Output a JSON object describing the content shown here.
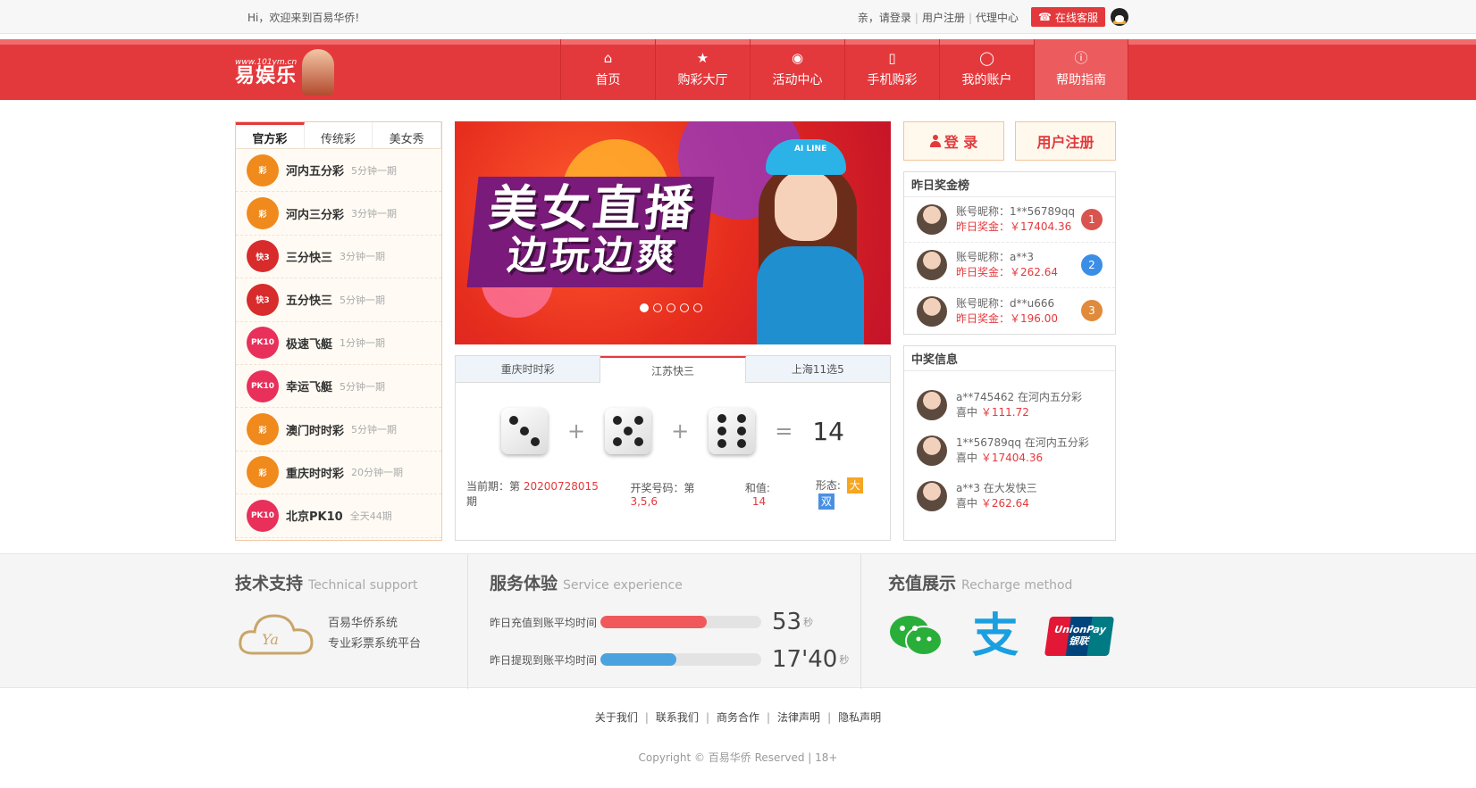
{
  "topbar": {
    "welcome": "Hi，欢迎来到百易华侨!",
    "login_prompt": "亲，请登录",
    "register": "用户注册",
    "agent": "代理中心",
    "service": "在线客服"
  },
  "nav": {
    "logo_url": "www.101ym.cn",
    "logo_name": "易娱乐",
    "items": [
      {
        "label": "首页",
        "icon": "home-icon"
      },
      {
        "label": "购彩大厅",
        "icon": "star-icon"
      },
      {
        "label": "活动中心",
        "icon": "gift-icon"
      },
      {
        "label": "手机购彩",
        "icon": "phone-icon"
      },
      {
        "label": "我的账户",
        "icon": "user-icon"
      },
      {
        "label": "帮助指南",
        "icon": "help-icon"
      }
    ]
  },
  "lottery": {
    "tabs": [
      "官方彩",
      "传统彩",
      "美女秀"
    ],
    "items": [
      {
        "name": "河内五分彩",
        "period": "5分钟一期",
        "logo": "orange",
        "logo_text": "彩"
      },
      {
        "name": "河内三分彩",
        "period": "3分钟一期",
        "logo": "orange",
        "logo_text": "彩"
      },
      {
        "name": "三分快三",
        "period": "3分钟一期",
        "logo": "red",
        "logo_text": "快3"
      },
      {
        "name": "五分快三",
        "period": "5分钟一期",
        "logo": "red",
        "logo_text": "快3"
      },
      {
        "name": "极速飞艇",
        "period": "1分钟一期",
        "logo": "pink",
        "logo_text": "PK10"
      },
      {
        "name": "幸运飞艇",
        "period": "5分钟一期",
        "logo": "pink",
        "logo_text": "PK10"
      },
      {
        "name": "澳门时时彩",
        "period": "5分钟一期",
        "logo": "orange",
        "logo_text": "彩"
      },
      {
        "name": "重庆时时彩",
        "period": "20分钟一期",
        "logo": "orange",
        "logo_text": "彩"
      },
      {
        "name": "北京PK10",
        "period": "全天44期",
        "logo": "pink",
        "logo_text": "PK10"
      }
    ]
  },
  "banner": {
    "line1": "美女直播",
    "line2": "边玩边爽",
    "cap_text": "AI LINE",
    "slides": 5,
    "active_slide": 0
  },
  "draw": {
    "tabs": [
      "重庆时时彩",
      "江苏快三",
      "上海11选5"
    ],
    "active_tab": 1,
    "dice": [
      3,
      5,
      6
    ],
    "plus": "+",
    "equals": "=",
    "sum": "14",
    "period_label": "当前期：第",
    "period": "20200728015",
    "period_suffix": "期",
    "result_label": "开奖号码：第",
    "result": "3,5,6",
    "sum_label": "和值:",
    "sum_value": "14",
    "shape_label": "形态:",
    "shape_big": "大",
    "shape_even": "双"
  },
  "auth": {
    "login": "登 录",
    "register": "用户注册"
  },
  "ranking": {
    "title": "昨日奖金榜",
    "items": [
      {
        "account": "账号昵称：1**56789qq",
        "prize": "昨日奖金：￥17404.36",
        "rank": "1",
        "color": "#d9534f"
      },
      {
        "account": "账号昵称：a**3",
        "prize": "昨日奖金：￥262.64",
        "rank": "2",
        "color": "#3a8ee6"
      },
      {
        "account": "账号昵称：d**u666",
        "prize": "昨日奖金：￥196.00",
        "rank": "3",
        "color": "#e08a3c"
      }
    ]
  },
  "wins": {
    "title": "中奖信息",
    "items": [
      {
        "line1": "a**745462 在河内五分彩",
        "label": "喜中",
        "amount": "￥111.72"
      },
      {
        "line1": "1**56789qq 在河内五分彩",
        "label": "喜中",
        "amount": "￥17404.36"
      },
      {
        "line1": "a**3 在大发快三",
        "label": "喜中",
        "amount": "￥262.64"
      }
    ]
  },
  "features": {
    "tech_title": "技术支持",
    "tech_sub": "Technical support",
    "tech_line1": "百易华侨系统",
    "tech_line2": "专业彩票系统平台",
    "tech_logo": "Ya",
    "service_title": "服务体验",
    "service_sub": "Service experience",
    "stats": [
      {
        "label": "昨日充值到账平均时间",
        "value": "53",
        "unit": "秒",
        "fill": 0.66,
        "color": "#f0595b"
      },
      {
        "label": "昨日提现到账平均时间",
        "value": "17'40",
        "unit": "秒",
        "fill": 0.47,
        "color": "#4aa3df"
      }
    ],
    "pay_title": "充值展示",
    "pay_sub": "Recharge method",
    "alipay_glyph": "支",
    "unionpay_en": "UnionPay",
    "unionpay_cn": "银联"
  },
  "footer": {
    "links": [
      "关于我们",
      "联系我们",
      "商务合作",
      "法律声明",
      "隐私声明"
    ],
    "copyright": "Copyright © 百易华侨 Reserved | 18+"
  }
}
